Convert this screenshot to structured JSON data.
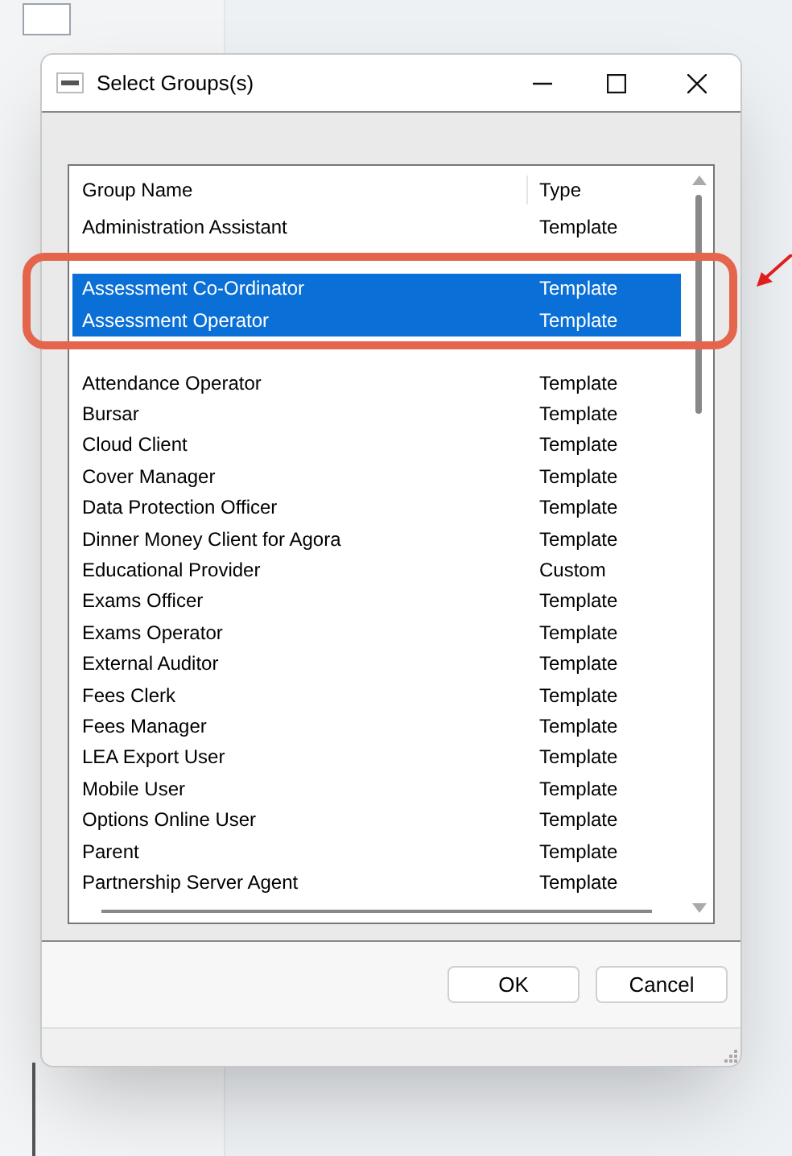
{
  "window": {
    "title": "Select Groups(s)"
  },
  "table": {
    "columns": [
      "Group Name",
      "Type"
    ],
    "rows": [
      {
        "name": "Administration Assistant",
        "type": "Template",
        "selected": false
      },
      {
        "name": "Assessment Co-Ordinator",
        "type": "Template",
        "selected": true
      },
      {
        "name": "Assessment Operator",
        "type": "Template",
        "selected": true
      },
      {
        "name": "Attendance Operator",
        "type": "Template",
        "selected": false
      },
      {
        "name": "Bursar",
        "type": "Template",
        "selected": false
      },
      {
        "name": "Cloud Client",
        "type": "Template",
        "selected": false
      },
      {
        "name": "Cover Manager",
        "type": "Template",
        "selected": false
      },
      {
        "name": "Data Protection Officer",
        "type": "Template",
        "selected": false
      },
      {
        "name": "Dinner Money Client for Agora",
        "type": "Template",
        "selected": false
      },
      {
        "name": "Educational Provider",
        "type": "Custom",
        "selected": false
      },
      {
        "name": "Exams Officer",
        "type": "Template",
        "selected": false
      },
      {
        "name": "Exams Operator",
        "type": "Template",
        "selected": false
      },
      {
        "name": "External Auditor",
        "type": "Template",
        "selected": false
      },
      {
        "name": "Fees Clerk",
        "type": "Template",
        "selected": false
      },
      {
        "name": "Fees Manager",
        "type": "Template",
        "selected": false
      },
      {
        "name": "LEA Export User",
        "type": "Template",
        "selected": false
      },
      {
        "name": "Mobile User",
        "type": "Template",
        "selected": false
      },
      {
        "name": "Options Online User",
        "type": "Template",
        "selected": false
      },
      {
        "name": "Parent",
        "type": "Template",
        "selected": false
      },
      {
        "name": "Partnership Server Agent",
        "type": "Template",
        "selected": false
      }
    ]
  },
  "buttons": [
    "OK",
    "Cancel"
  ]
}
